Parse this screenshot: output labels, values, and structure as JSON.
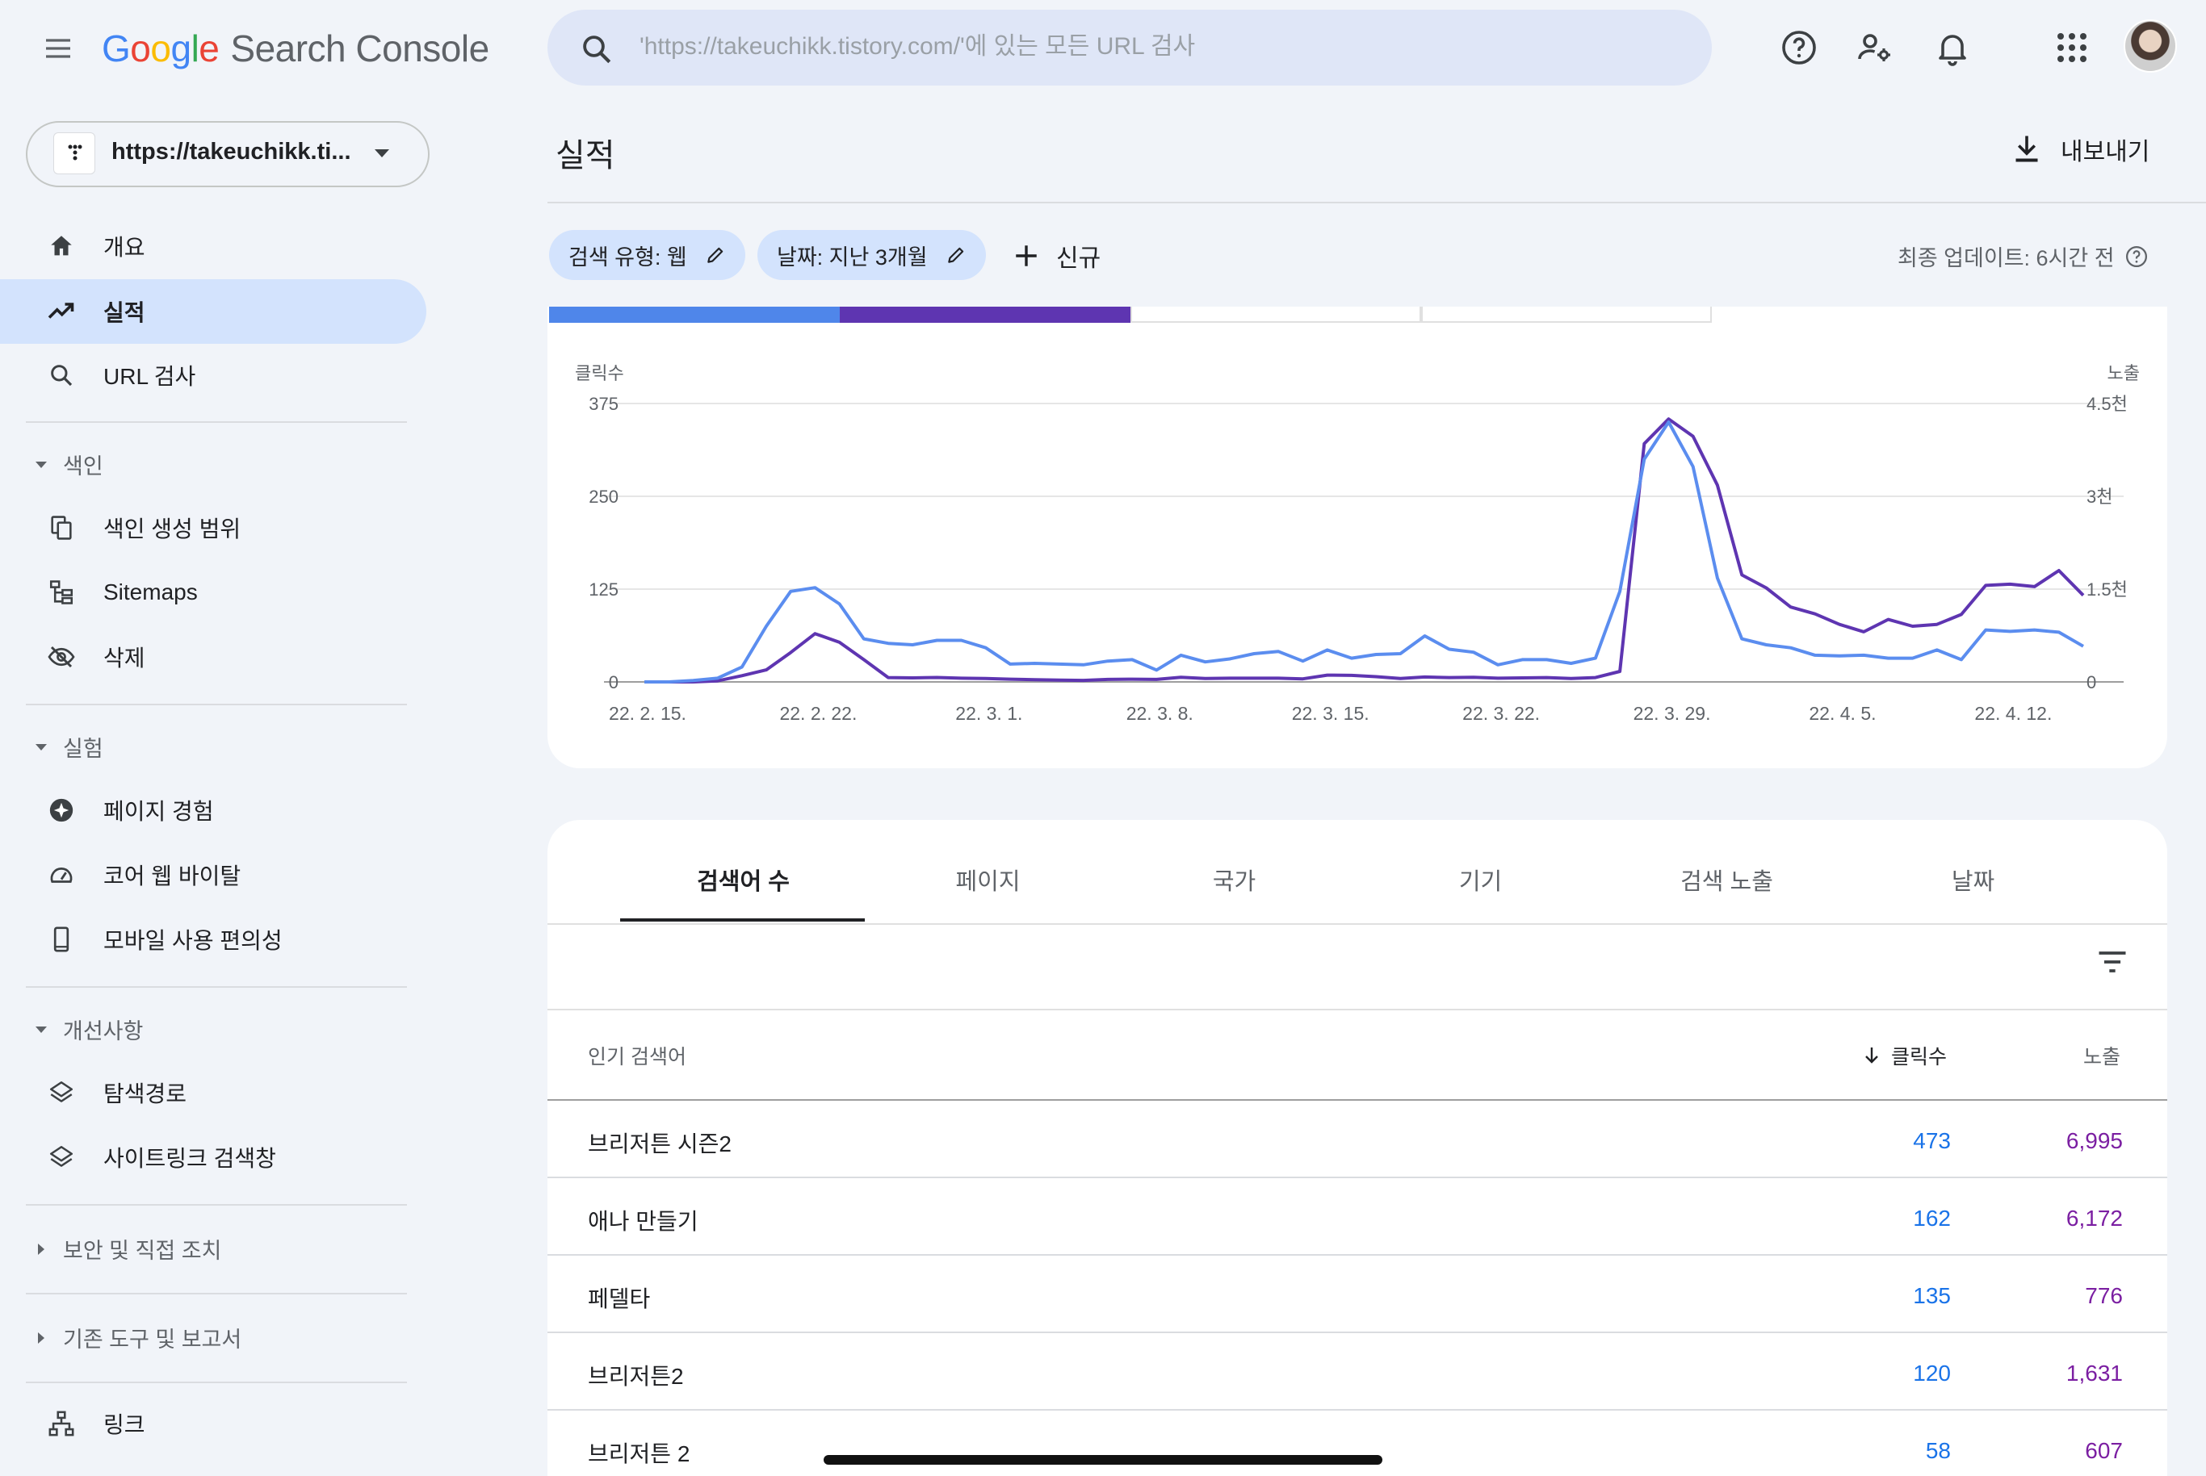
{
  "app": {
    "title_logo": "Google",
    "title_product": "Search Console"
  },
  "search": {
    "placeholder": "'https://takeuchikk.tistory.com/'에 있는 모든 URL 검사"
  },
  "property": {
    "url": "https://takeuchikk.ti..."
  },
  "sidebar": {
    "items": [
      {
        "label": "개요",
        "icon": "home-icon"
      },
      {
        "label": "실적",
        "icon": "trending-up-icon",
        "active": true
      },
      {
        "label": "URL 검사",
        "icon": "search-icon"
      }
    ],
    "sections": {
      "index": "색인",
      "experience": "실험",
      "enhancements": "개선사항",
      "security": "보안 및 직접 조치",
      "legacy": "기존 도구 및 보고서"
    },
    "index_items": [
      {
        "label": "색인 생성 범위",
        "icon": "pages-icon"
      },
      {
        "label": "Sitemaps",
        "icon": "sitemap-icon"
      },
      {
        "label": "삭제",
        "icon": "visibility-off-icon"
      }
    ],
    "experience_items": [
      {
        "label": "페이지 경험",
        "icon": "page-experience-icon"
      },
      {
        "label": "코어 웹 바이탈",
        "icon": "speed-icon"
      },
      {
        "label": "모바일 사용 편의성",
        "icon": "mobile-icon"
      }
    ],
    "enhancement_items": [
      {
        "label": "탐색경로",
        "icon": "layers-icon"
      },
      {
        "label": "사이트링크 검색창",
        "icon": "layers-icon"
      }
    ],
    "links_item": {
      "label": "링크",
      "icon": "links-icon"
    }
  },
  "main": {
    "title": "실적",
    "export_label": "내보내기",
    "filters": [
      {
        "label": "검색 유형: 웹"
      },
      {
        "label": "날짜: 지난 3개월"
      }
    ],
    "new_label": "신규",
    "last_updated": "최종 업데이트: 6시간 전"
  },
  "colors": {
    "clicks": "#5b8def",
    "impressions": "#5e35b1"
  },
  "chart_data": {
    "type": "line",
    "ylabel": "클릭수",
    "ylabel_right": "노출",
    "y_ticks": [
      "375",
      "250",
      "125",
      "0"
    ],
    "y_ticks_right": [
      "4.5천",
      "3천",
      "1.5천",
      "0"
    ],
    "ylim": [
      0,
      375
    ],
    "ylim_right": [
      0,
      4500
    ],
    "x_ticks": [
      "22. 2. 15.",
      "22. 2. 22.",
      "22. 3. 1.",
      "22. 3. 8.",
      "22. 3. 15.",
      "22. 3. 22.",
      "22. 3. 29.",
      "22. 4. 5.",
      "22. 4. 12."
    ],
    "series": [
      {
        "values": [
          0,
          0,
          2,
          5,
          20,
          75,
          122,
          127,
          105,
          58,
          52,
          50,
          56,
          56,
          46,
          24,
          25,
          24,
          23,
          28,
          30,
          16,
          36,
          27,
          31,
          38,
          41,
          28,
          43,
          32,
          37,
          38,
          62,
          44,
          40,
          23,
          30,
          30,
          25,
          32,
          122,
          300,
          350,
          290,
          140,
          58,
          50,
          46,
          36,
          35,
          36,
          32,
          32,
          43,
          30,
          70,
          68,
          70,
          67,
          48
        ]
      },
      {
        "values": [
          0,
          0,
          0,
          17,
          100,
          195,
          475,
          780,
          640,
          360,
          70,
          65,
          72,
          60,
          55,
          45,
          35,
          30,
          25,
          40,
          45,
          40,
          75,
          55,
          60,
          60,
          60,
          50,
          110,
          105,
          85,
          55,
          80,
          70,
          75,
          60,
          65,
          70,
          55,
          70,
          170,
          3850,
          4250,
          3970,
          3180,
          1730,
          1520,
          1210,
          1100,
          930,
          810,
          1010,
          900,
          930,
          1090,
          1560,
          1580,
          1540,
          1800,
          1400
        ]
      }
    ]
  },
  "table": {
    "tabs": [
      "검색어 수",
      "페이지",
      "국가",
      "기기",
      "검색 노출",
      "날짜"
    ],
    "headers": {
      "query": "인기 검색어",
      "clicks": "클릭수",
      "impressions": "노출"
    },
    "rows": [
      {
        "query": "브리저튼 시즌2",
        "clicks": "473",
        "impressions": "6,995"
      },
      {
        "query": "애나 만들기",
        "clicks": "162",
        "impressions": "6,172"
      },
      {
        "query": "페델타",
        "clicks": "135",
        "impressions": "776"
      },
      {
        "query": "브리저튼2",
        "clicks": "120",
        "impressions": "1,631"
      },
      {
        "query": "브리저튼 2",
        "clicks": "58",
        "impressions": "607"
      }
    ]
  }
}
